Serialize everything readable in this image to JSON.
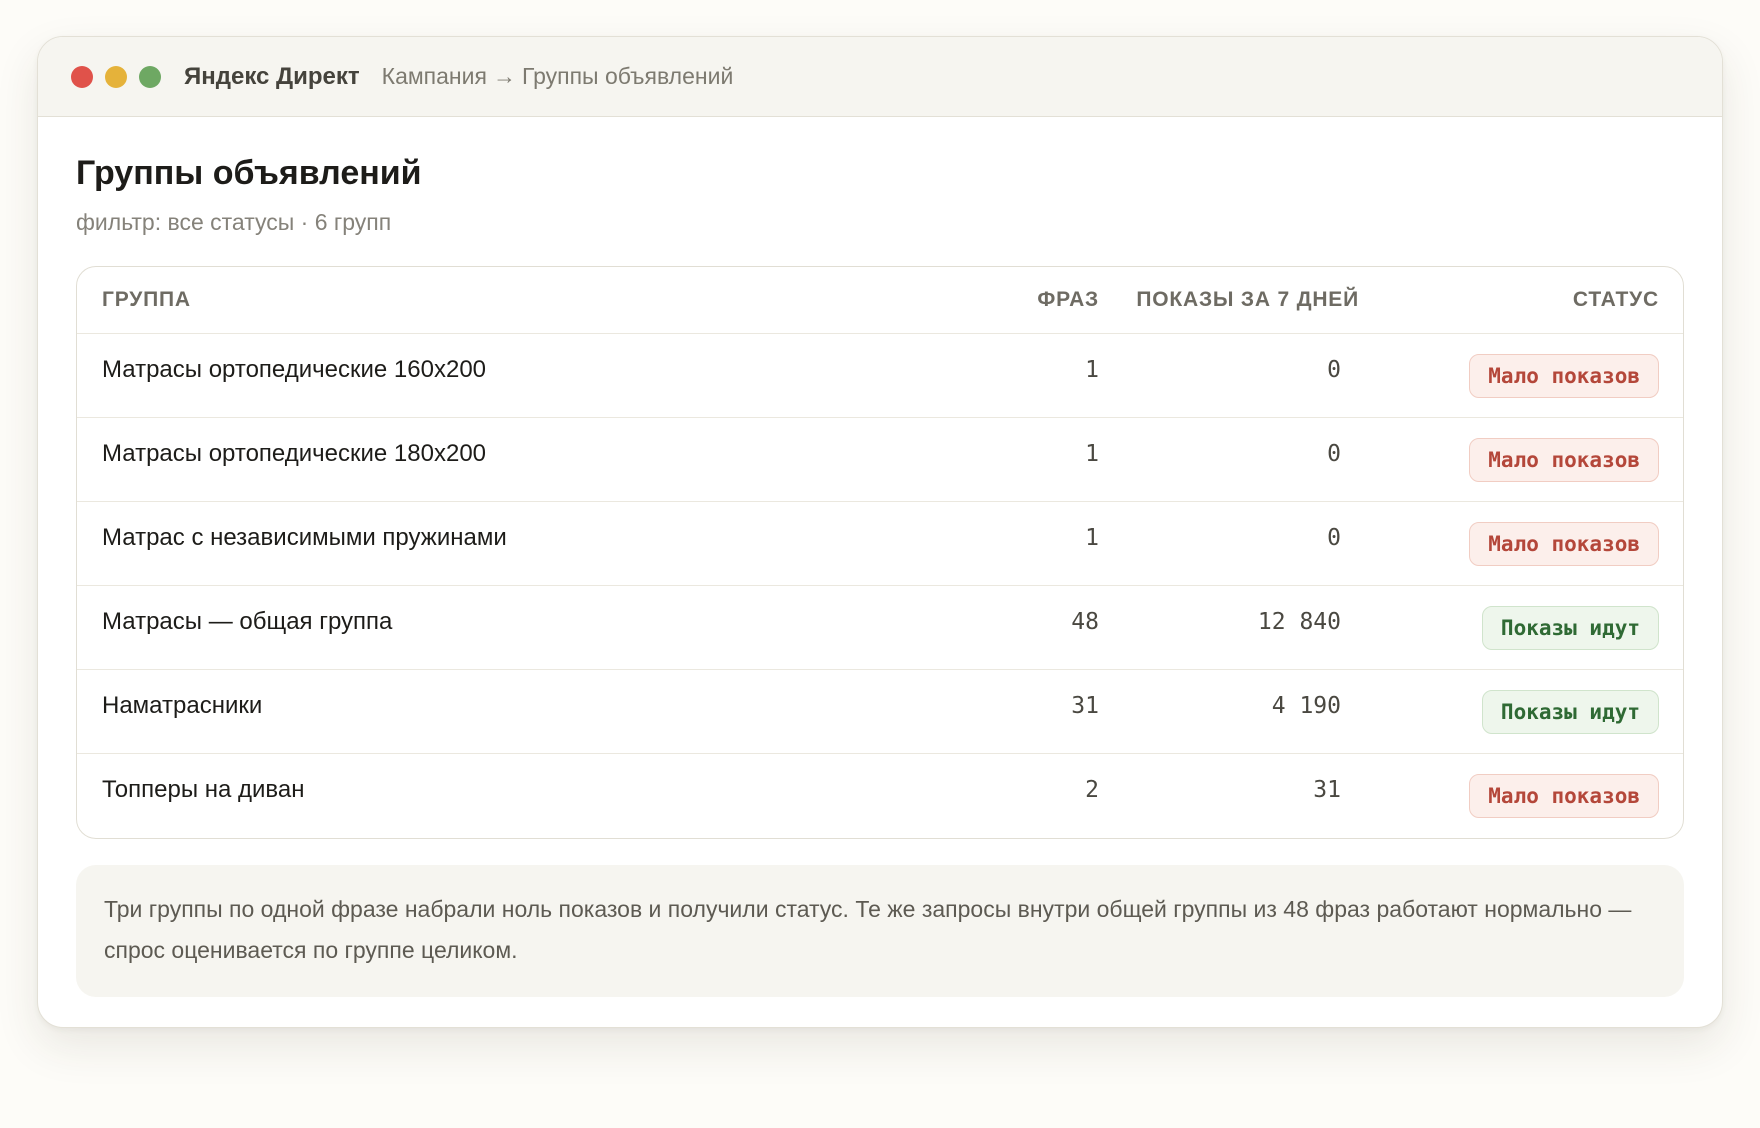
{
  "window": {
    "app_title": "Яндекс Директ",
    "breadcrumb": {
      "parent": "Кампания",
      "separator": "→",
      "current": "Группы объявлений"
    }
  },
  "page": {
    "title": "Группы объявлений",
    "subtitle": "фильтр: все статусы · 6 групп"
  },
  "table": {
    "headers": {
      "group": "Группа",
      "phrases": "Фраз",
      "shows": "Показы за 7 дней",
      "status": "Статус"
    },
    "rows": [
      {
        "group": "Матрасы ортопедические 160х200",
        "phrases": "1",
        "shows": "0",
        "status": "Мало показов",
        "status_kind": "low"
      },
      {
        "group": "Матрасы ортопедические 180х200",
        "phrases": "1",
        "shows": "0",
        "status": "Мало показов",
        "status_kind": "low"
      },
      {
        "group": "Матрас с независимыми пружинами",
        "phrases": "1",
        "shows": "0",
        "status": "Мало показов",
        "status_kind": "low"
      },
      {
        "group": "Матрасы — общая группа",
        "phrases": "48",
        "shows": "12 840",
        "status": "Показы идут",
        "status_kind": "ok"
      },
      {
        "group": "Наматрасники",
        "phrases": "31",
        "shows": "4 190",
        "status": "Показы идут",
        "status_kind": "ok"
      },
      {
        "group": "Топперы на диван",
        "phrases": "2",
        "shows": "31",
        "status": "Мало показов",
        "status_kind": "low"
      }
    ]
  },
  "note": "Три группы по одной фразе набрали ноль показов и получили статус. Те же запросы внутри общей группы из 48 фраз работают нормально — спрос оценивается по группе целиком.",
  "colors": {
    "dot_close": "#e0524a",
    "dot_minimize": "#e5b23a",
    "dot_maximize": "#6ea863",
    "status_low": "#b4473a",
    "status_ok": "#2f6a34"
  }
}
